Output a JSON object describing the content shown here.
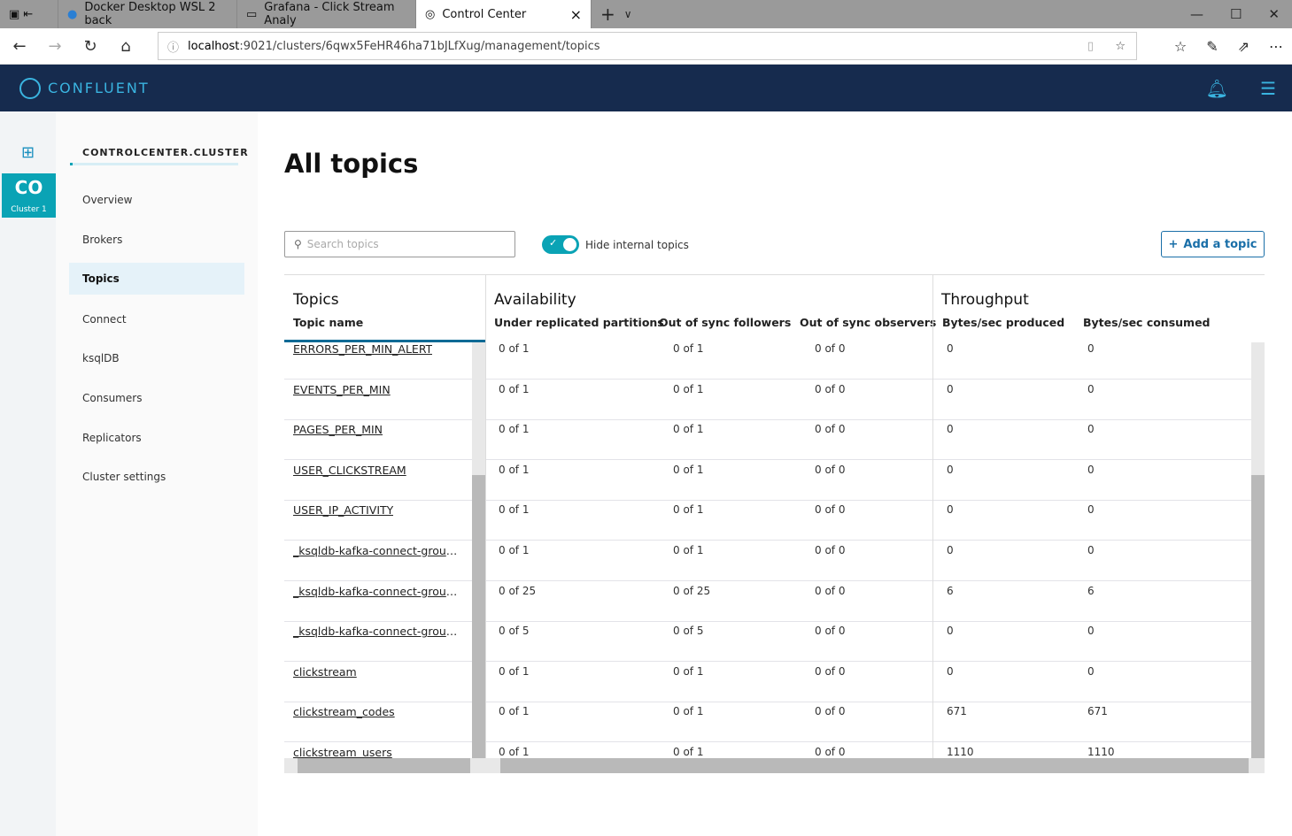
{
  "browser": {
    "tabs": [
      "Docker Desktop WSL 2 back",
      "Grafana - Click Stream Analy",
      "Control Center"
    ],
    "url_host": "localhost",
    "url_path": ":9021/clusters/6qwx5FeHR46ha71bJLfXug/management/topics"
  },
  "app": {
    "brand": "CONFLUENT",
    "cluster_badge": "CO",
    "cluster_badge_sub": "Cluster 1",
    "cluster_name": "CONTROLCENTER.CLUSTER"
  },
  "sidebar": {
    "items": [
      "Overview",
      "Brokers",
      "Topics",
      "Connect",
      "ksqlDB",
      "Consumers",
      "Replicators",
      "Cluster settings"
    ],
    "active": "Topics"
  },
  "page": {
    "title": "All topics",
    "search_placeholder": "Search topics",
    "toggle_label": "Hide internal topics",
    "toggle_on": true,
    "add_button": "Add a topic"
  },
  "table": {
    "groups": [
      "Topics",
      "Availability",
      "Throughput"
    ],
    "columns": [
      "Topic name",
      "Under replicated partitions",
      "Out of sync followers",
      "Out of sync observers",
      "Bytes/sec produced",
      "Bytes/sec consumed"
    ],
    "rows": [
      [
        "ERRORS_PER_MIN_ALERT",
        "0 of 1",
        "0 of 1",
        "0 of 0",
        "0",
        "0"
      ],
      [
        "EVENTS_PER_MIN",
        "0 of 1",
        "0 of 1",
        "0 of 0",
        "0",
        "0"
      ],
      [
        "PAGES_PER_MIN",
        "0 of 1",
        "0 of 1",
        "0 of 0",
        "0",
        "0"
      ],
      [
        "USER_CLICKSTREAM",
        "0 of 1",
        "0 of 1",
        "0 of 0",
        "0",
        "0"
      ],
      [
        "USER_IP_ACTIVITY",
        "0 of 1",
        "0 of 1",
        "0 of 0",
        "0",
        "0"
      ],
      [
        "_ksqldb-kafka-connect-group...",
        "0 of 1",
        "0 of 1",
        "0 of 0",
        "0",
        "0"
      ],
      [
        "_ksqldb-kafka-connect-group...",
        "0 of 25",
        "0 of 25",
        "0 of 0",
        "6",
        "6"
      ],
      [
        "_ksqldb-kafka-connect-group...",
        "0 of 5",
        "0 of 5",
        "0 of 0",
        "0",
        "0"
      ],
      [
        "clickstream",
        "0 of 1",
        "0 of 1",
        "0 of 0",
        "0",
        "0"
      ],
      [
        "clickstream_codes",
        "0 of 1",
        "0 of 1",
        "0 of 0",
        "671",
        "671"
      ],
      [
        "clickstream_users",
        "0 of 1",
        "0 of 1",
        "0 of 0",
        "1110",
        "1110"
      ]
    ]
  }
}
